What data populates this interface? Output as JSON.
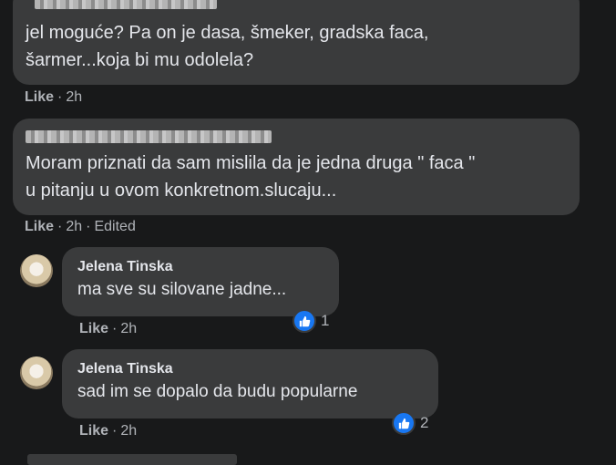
{
  "comments": [
    {
      "author_redacted": true,
      "text": "jel moguće? Pa on je dasa, šmeker, gradska faca,\nšarmer...koja bi mu odolela?",
      "actions": {
        "like": "Like",
        "time": "2h"
      }
    },
    {
      "author_redacted": true,
      "text": "Moram priznati da sam mislila da je jedna druga \" faca \"\nu pitanju u ovom konkretnom.slucaju...",
      "actions": {
        "like": "Like",
        "time": "2h",
        "edited": "Edited"
      }
    }
  ],
  "replies": [
    {
      "author": "Jelena Tinska",
      "text": "ma sve su silovane jadne...",
      "reaction_count": "1",
      "actions": {
        "like": "Like",
        "time": "2h"
      }
    },
    {
      "author": "Jelena Tinska",
      "text": "sad im se dopalo da budu popularne",
      "reaction_count": "2",
      "actions": {
        "like": "Like",
        "time": "2h"
      }
    }
  ],
  "colors": {
    "background": "#18191a",
    "bubble": "#3a3b3c",
    "text": "#e4e6eb",
    "secondary_text": "#b0b3b8",
    "like_blue": "#1877f2"
  }
}
